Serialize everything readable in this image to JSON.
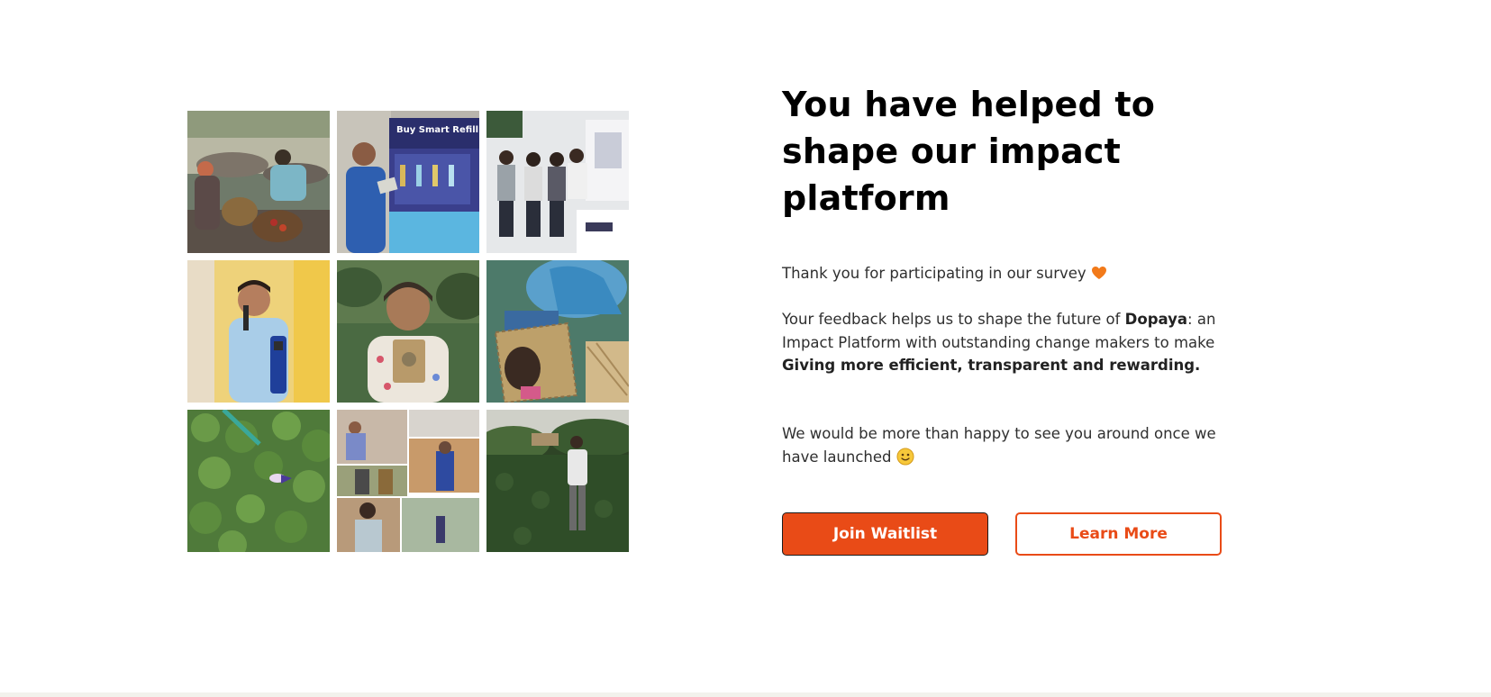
{
  "gallery": {
    "photos": [
      {
        "icon": "photo-women-washing-at-stream"
      },
      {
        "icon": "photo-man-at-smart-refill-station",
        "sign_text": "Buy Smart Refill"
      },
      {
        "icon": "photo-group-at-exhibition-stand"
      },
      {
        "icon": "photo-speaker-with-microphone"
      },
      {
        "icon": "photo-woman-holding-product-pouch"
      },
      {
        "icon": "photo-hands-weaving-baskets"
      },
      {
        "icon": "photo-water-hyacinth-field"
      },
      {
        "icon": "photo-collage-of-field-workers"
      },
      {
        "icon": "photo-man-standing-in-field"
      }
    ]
  },
  "hero": {
    "title": "You have helped to shape our impact platform",
    "thanks_text": "Thank you for participating in our survey",
    "feedback_prefix": "Your feedback helps us to shape the future of ",
    "brand": "Dopaya",
    "feedback_middle": ": an Impact Platform with outstanding change makers to make ",
    "feedback_bold": "Giving more efficient, transparent and rewarding.",
    "launch_text": "We would be more than happy to see you around once we have launched"
  },
  "actions": {
    "join_label": "Join Waitlist",
    "learn_label": "Learn More"
  },
  "colors": {
    "accent": "#e94b17",
    "heart": "#f27a1a",
    "footer": "#f2f2ec"
  }
}
